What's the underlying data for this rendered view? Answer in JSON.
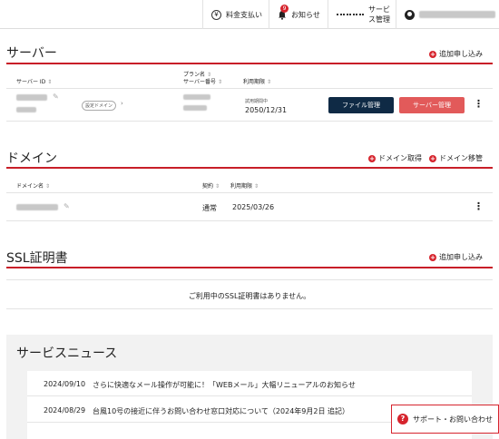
{
  "topbar": {
    "billing_label": "料金支払い",
    "billing_icon": "yen",
    "notice_label": "お知らせ",
    "notice_badge": "9",
    "services_label": "サービス管理",
    "account_icon": "user-icon"
  },
  "server": {
    "title": "サーバー",
    "add_label": "追加申し込み",
    "col_server_id": "サーバー ID",
    "col_plan": "プラン名",
    "col_server_no": "サーバー番号",
    "col_period": "利用期限",
    "tag_label": "設定ドメイン",
    "tag_arrow": "›",
    "trial_label": "試用期間中",
    "expiry": "2050/12/31",
    "file_button": "ファイル管理",
    "server_button": "サーバー管理"
  },
  "domain": {
    "title": "ドメイン",
    "acquire_label": "ドメイン取得",
    "transfer_label": "ドメイン移管",
    "col_domain": "ドメイン名",
    "col_contract": "契約",
    "col_period": "利用期限",
    "contract_value": "通常",
    "expiry": "2025/03/26"
  },
  "ssl": {
    "title": "SSL証明書",
    "add_label": "追加申し込み",
    "empty_message": "ご利用中のSSL証明書はありません。"
  },
  "news": {
    "title": "サービスニュース",
    "items": [
      {
        "date": "2024/09/10",
        "text": "さらに快適なメール操作が可能に！「WEBメール」大幅リニューアルのお知らせ"
      },
      {
        "date": "2024/08/29",
        "text": "台風10号の接近に伴うお問い合わせ窓口対応について（2024年9月2日 追記）"
      }
    ]
  },
  "support": {
    "label": "サポート・お問い合わせ",
    "accent": "#d6242d"
  },
  "colors": {
    "accent_red": "#c81e28",
    "dark_button": "#0f2a45",
    "red_button": "#e25a5a"
  }
}
